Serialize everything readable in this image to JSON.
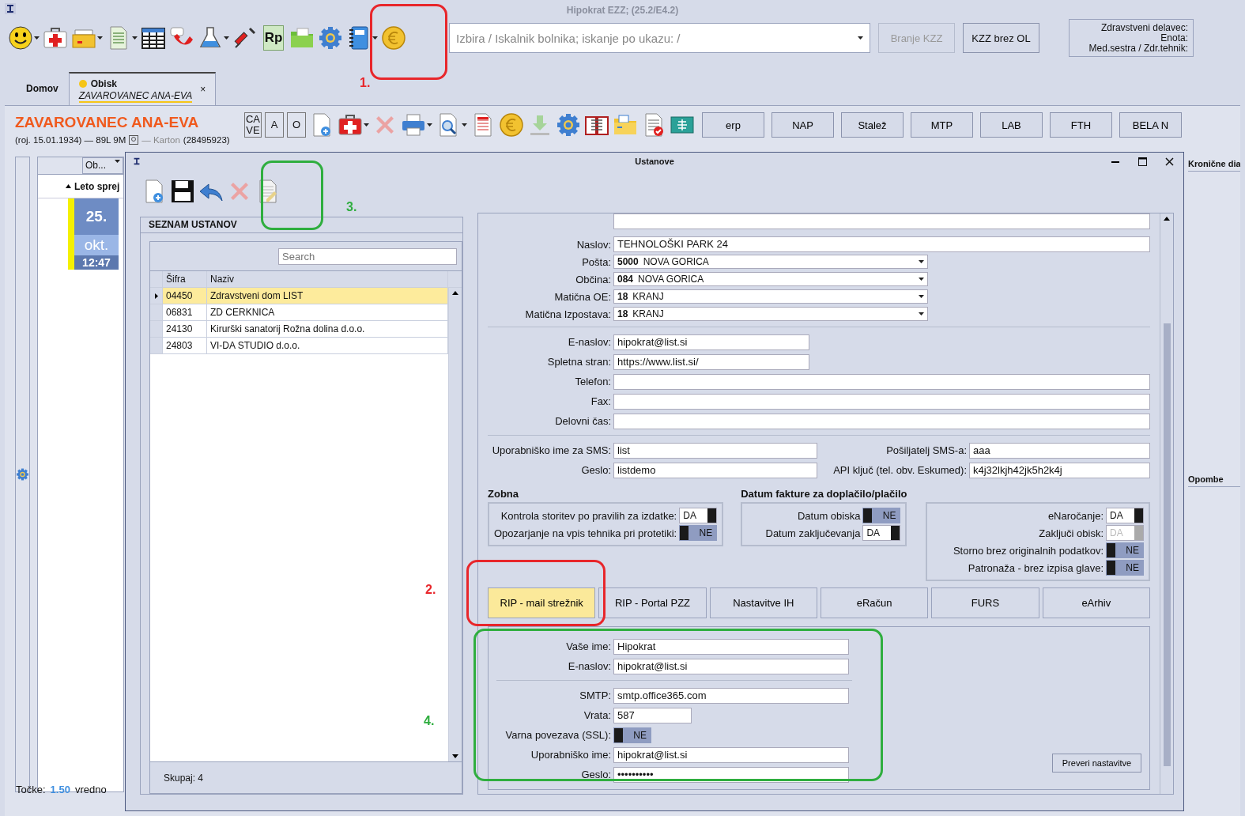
{
  "app": {
    "title": "Hipokrat EZZ; (25.2/E4.2)"
  },
  "toolbar": {
    "prescription_label": "Rp",
    "search": {
      "placeholder": "Izbira / Iskalnik bolnika; iskanje po ukazu: /"
    },
    "buttons": [
      {
        "label": "Branje KZZ",
        "disabled": true
      },
      {
        "label": "KZZ brez OL",
        "disabled": false
      }
    ],
    "user_info": [
      "Zdravstveni delavec:",
      "Enota:",
      "Med.sestra / Zdr.tehnik:"
    ]
  },
  "tabs": [
    {
      "label": "Domov",
      "selected": false
    },
    {
      "label": "Obisk",
      "subtitle": "ZAVAROVANEC ANA-EVA",
      "close": "×",
      "selected": true
    }
  ],
  "patient": {
    "name": "ZAVAROVANEC ANA-EVA",
    "details": "(roj. 15.01.1934) — 89L 9M",
    "karton_label": "— Karton",
    "karton_number": "(28495923)"
  },
  "patient_toolbar": {
    "letter_buttons": [
      "CA VE",
      "A",
      "O"
    ],
    "module_buttons": [
      "erp",
      "NAP",
      "Stalež",
      "MTP",
      "LAB",
      "FTH",
      "BELA N"
    ]
  },
  "visits": {
    "column": "Ob...",
    "group": "Leto sprej",
    "visit": {
      "day": "25.",
      "month": "okt.",
      "time": "12:47"
    }
  },
  "side_labels": [
    "Kronične dia",
    "Opombe"
  ],
  "footer": {
    "label": "Točke:",
    "value": "1.50",
    "trailing": "vredno"
  },
  "dialog": {
    "title": "Ustanove",
    "list": {
      "title": "SEZNAM USTANOV",
      "search": {
        "placeholder": "Search"
      },
      "columns": [
        "Šifra",
        "Naziv"
      ],
      "rows": [
        {
          "code": "04450",
          "name": "Zdravstveni dom LIST",
          "selected": true
        },
        {
          "code": "06831",
          "name": "ZD CERKNICA",
          "selected": false
        },
        {
          "code": "24130",
          "name": "Kirurški sanatorij Rožna dolina d.o.o.",
          "selected": false
        },
        {
          "code": "24803",
          "name": "VI-DA STUDIO d.o.o.",
          "selected": false
        }
      ],
      "total": "Skupaj: 4"
    },
    "address": [
      {
        "kind": "field",
        "label": "Naslov:",
        "value": "TEHNOLOŠKI PARK 24"
      },
      {
        "kind": "combo",
        "label": "Pošta:",
        "code": "5000",
        "value": "NOVA GORICA"
      },
      {
        "kind": "combo",
        "label": "Občina:",
        "code": "084",
        "value": "NOVA GORICA"
      },
      {
        "kind": "combo",
        "label": "Matična OE:",
        "code": "18",
        "value": "KRANJ"
      },
      {
        "kind": "combo",
        "label": "Matična Izpostava:",
        "code": "18",
        "value": "KRANJ"
      }
    ],
    "contact": [
      {
        "kind": "short",
        "label": "E-naslov:",
        "value": "hipokrat@list.si"
      },
      {
        "kind": "short",
        "label": "Spletna stran:",
        "value": "https://www.list.si/"
      },
      {
        "kind": "field",
        "label": "Telefon:"
      },
      {
        "kind": "field",
        "label": "Fax:"
      },
      {
        "kind": "field",
        "label": "Delovni čas:"
      }
    ],
    "sms": [
      {
        "label": "Uporabniško ime za SMS:",
        "value": "list",
        "label_2": "Pošiljatelj SMS-a:",
        "value_2": "aaa"
      },
      {
        "label": "Geslo:",
        "value": "listdemo",
        "label_2": "API ključ (tel. obv. Eskumed):",
        "value_2": "k4j32lkjh42jk5h2k4j"
      }
    ],
    "groups": [
      {
        "title": "Zobna",
        "toggles": [
          {
            "label": "Kontrola storitev po pravilih za izdatke:",
            "on": true,
            "text": "DA"
          },
          {
            "label": "Opozarjanje na vpis tehnika pri protetiki:",
            "on": false,
            "text": "NE"
          }
        ]
      },
      {
        "title": "Datum fakture za doplačilo/plačilo",
        "toggles": [
          {
            "label": "Datum obiska",
            "on": false,
            "text": "NE"
          },
          {
            "label": "Datum zaključevanja",
            "on": true,
            "text": "DA"
          }
        ]
      },
      {
        "toggles": [
          {
            "label": "eNaročanje:",
            "on": true,
            "text": "DA"
          },
          {
            "label": "Zaključi obisk:",
            "on": true,
            "disabled": true,
            "text": "DA"
          },
          {
            "label": "Storno brez originalnih podatkov:",
            "on": false,
            "text": "NE"
          },
          {
            "label": "Patronaža - brez izpisa glave:",
            "on": false,
            "text": "NE"
          }
        ]
      }
    ],
    "tabs": [
      {
        "label": "RIP - mail strežnik",
        "selected": true
      },
      {
        "label": "RIP - Portal PZZ",
        "selected": false
      },
      {
        "label": "Nastavitve IH",
        "selected": false
      },
      {
        "label": "eRačun",
        "selected": false
      },
      {
        "label": "FURS",
        "selected": false
      },
      {
        "label": "eArhiv",
        "selected": false
      }
    ],
    "mail": {
      "sections": [
        [
          {
            "kind": "field",
            "label": "Vaše ime:",
            "value": "Hipokrat"
          },
          {
            "kind": "field",
            "label": "E-naslov:",
            "value": "hipokrat@list.si"
          }
        ],
        [
          {
            "kind": "field",
            "label": "SMTP:",
            "value": "smtp.office365.com"
          },
          {
            "kind": "small",
            "label": "Vrata:",
            "value": "587"
          },
          {
            "kind": "toggle",
            "label": "Varna povezava (SSL):",
            "on": false,
            "text": "NE"
          },
          {
            "kind": "field",
            "label": "Uporabniško ime:",
            "value": "hipokrat@list.si"
          },
          {
            "kind": "password",
            "label": "Geslo:",
            "value": "••••••••••"
          }
        ]
      ],
      "button": "Preveri nastavitve"
    }
  },
  "annotations": [
    {
      "number": "1.",
      "color": "#e8262b"
    },
    {
      "number": "2.",
      "color": "#e8262b"
    },
    {
      "number": "3.",
      "color": "#2fae3f"
    },
    {
      "number": "4.",
      "color": "#2fae3f"
    }
  ]
}
